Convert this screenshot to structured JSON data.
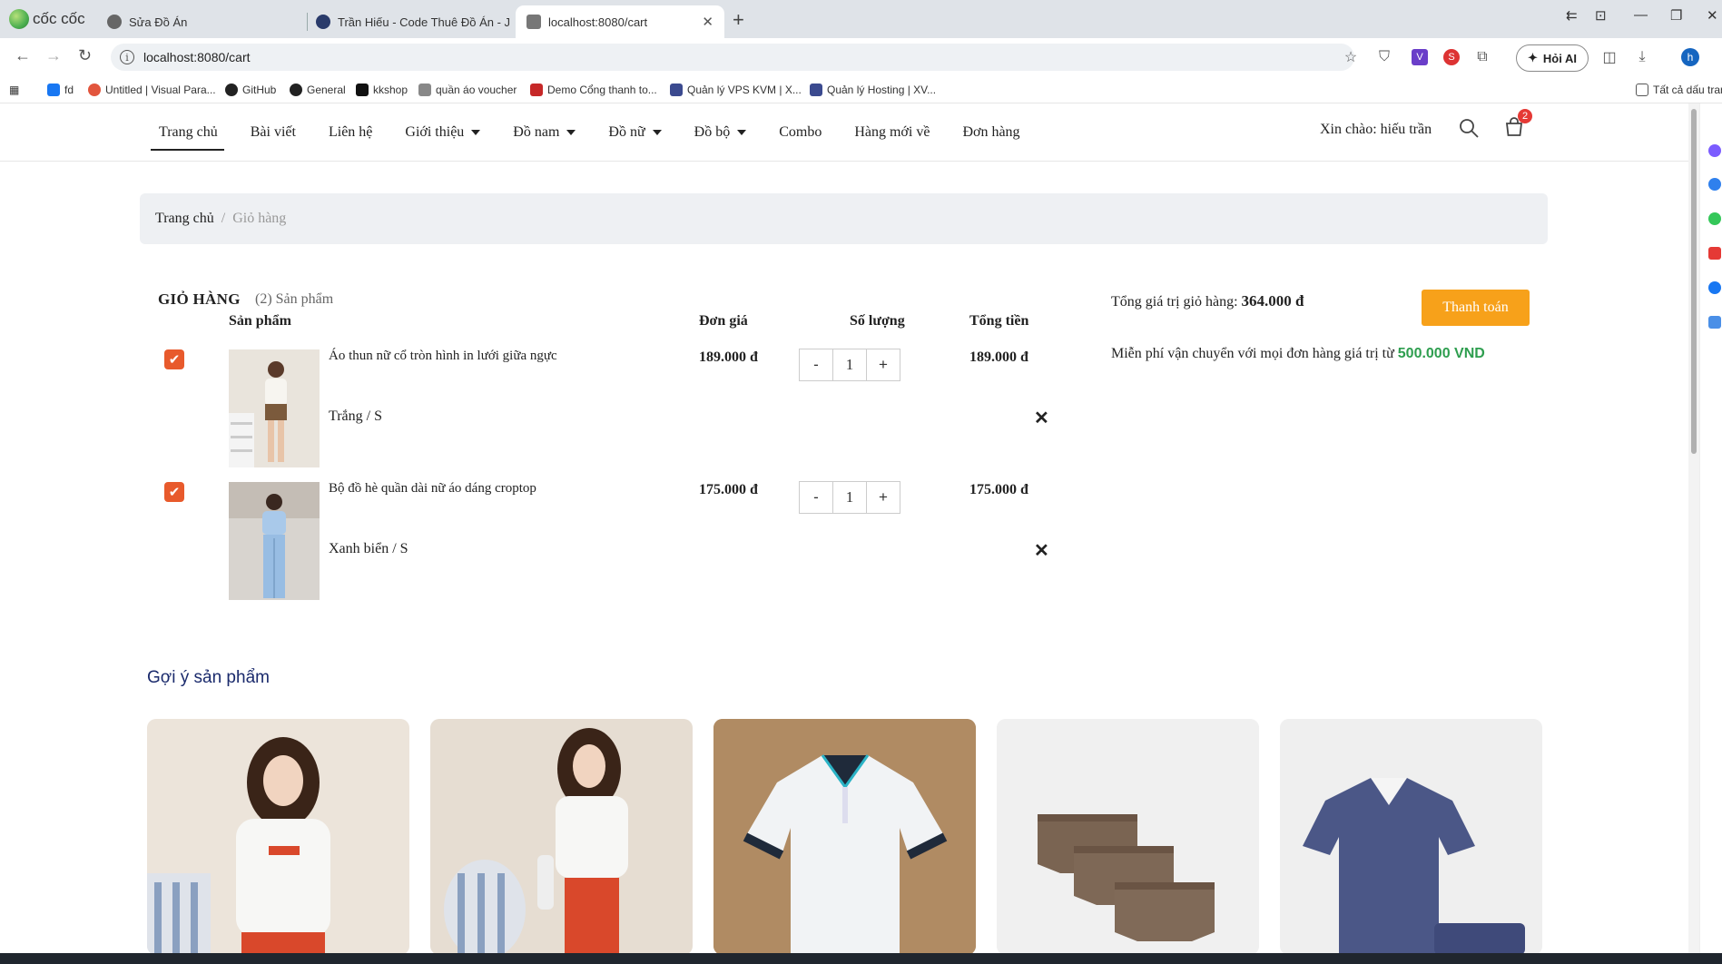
{
  "browser": {
    "brand": "cốc cốc",
    "tabs": [
      {
        "title": "Sửa Đồ Án",
        "active": false
      },
      {
        "title": "Trần Hiếu - Code Thuê Đồ Án - J",
        "active": false
      },
      {
        "title": "localhost:8080/cart",
        "active": true
      }
    ],
    "url": "localhost:8080/cart",
    "ai_button": "Hỏi AI",
    "profile_initial": "h",
    "bookmarks": [
      "fd",
      "Untitled | Visual Para...",
      "GitHub",
      "General",
      "kkshop",
      "quần áo voucher",
      "Demo Cổng thanh to...",
      "Quản lý VPS KVM | X...",
      "Quản lý Hosting | XV..."
    ],
    "all_bookmarks": "Tất cả dấu tran"
  },
  "site": {
    "nav": [
      {
        "label": "Trang chủ",
        "dropdown": false,
        "active": true
      },
      {
        "label": "Bài viết",
        "dropdown": false,
        "active": false
      },
      {
        "label": "Liên hệ",
        "dropdown": false,
        "active": false
      },
      {
        "label": "Giới thiệu",
        "dropdown": true,
        "active": false
      },
      {
        "label": "Đồ nam",
        "dropdown": true,
        "active": false
      },
      {
        "label": "Đồ nữ",
        "dropdown": true,
        "active": false
      },
      {
        "label": "Đồ bộ",
        "dropdown": true,
        "active": false
      },
      {
        "label": "Combo",
        "dropdown": false,
        "active": false
      },
      {
        "label": "Hàng mới về",
        "dropdown": false,
        "active": false
      },
      {
        "label": "Đơn hàng",
        "dropdown": false,
        "active": false
      }
    ],
    "greeting": "Xin chào: hiếu trần",
    "cart_badge": "2"
  },
  "breadcrumb": {
    "home": "Trang chủ",
    "separator": "/",
    "current": "Giỏ hàng"
  },
  "cart": {
    "title": "GIỎ HÀNG",
    "count": "(2) Sản phẩm",
    "headers": {
      "product": "Sản phẩm",
      "unit_price": "Đơn giá",
      "quantity": "Số lượng",
      "total": "Tổng tiền"
    },
    "items": [
      {
        "name": "Áo thun nữ cổ tròn hình in lưới giữa ngực",
        "variant": "Trắng / S",
        "price": "189.000 đ",
        "qty": "1",
        "total": "189.000 đ",
        "minus": "-",
        "plus": "+"
      },
      {
        "name": "Bộ đồ hè quần dài nữ áo dáng croptop",
        "variant": "Xanh biển / S",
        "price": "175.000 đ",
        "qty": "1",
        "total": "175.000 đ",
        "minus": "-",
        "plus": "+"
      }
    ],
    "summary_label": "Tổng giá trị giỏ hàng:",
    "summary_value": "364.000 đ",
    "checkout": "Thanh toán",
    "shipping_note": "Miễn phí vận chuyển với mọi đơn hàng giá trị từ",
    "shipping_amount": "500.000 VND"
  },
  "suggestions": {
    "title": "Gợi ý sản phẩm"
  },
  "colors": {
    "accent": "#f7a11a",
    "check": "#e85a2c",
    "ship": "#2e9e4f",
    "suggest_title": "#1a2a6c"
  }
}
